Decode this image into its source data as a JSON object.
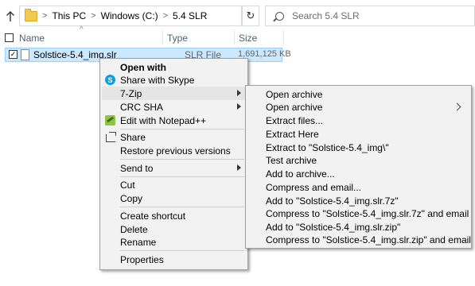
{
  "address_bar": {
    "crumbs": [
      "This PC",
      "Windows (C:)",
      "5.4 SLR"
    ],
    "search_placeholder": "Search 5.4 SLR"
  },
  "columns": {
    "name": "Name",
    "type": "Type",
    "size": "Size"
  },
  "file": {
    "name": "Solstice-5.4_img.slr",
    "type": "SLR File",
    "size": "1,691,125 KB",
    "checked": true
  },
  "context_menu": {
    "open_with": "Open with",
    "share_skype": "Share with Skype",
    "seven_zip": "7-Zip",
    "crc_sha": "CRC SHA",
    "edit_notepad": "Edit with Notepad++",
    "share": "Share",
    "restore": "Restore previous versions",
    "send_to": "Send to",
    "cut": "Cut",
    "copy": "Copy",
    "create_shortcut": "Create shortcut",
    "delete": "Delete",
    "rename": "Rename",
    "properties": "Properties"
  },
  "submenu_7zip": {
    "items": [
      "Open archive",
      "Open archive",
      "Extract files...",
      "Extract Here",
      "Extract to \"Solstice-5.4_img\\\"",
      "Test archive",
      "Add to archive...",
      "Compress and email...",
      "Add to \"Solstice-5.4_img.slr.7z\"",
      "Compress to \"Solstice-5.4_img.slr.7z\" and email",
      "Add to \"Solstice-5.4_img.slr.zip\"",
      "Compress to \"Solstice-5.4_img.slr.zip\" and email"
    ]
  }
}
